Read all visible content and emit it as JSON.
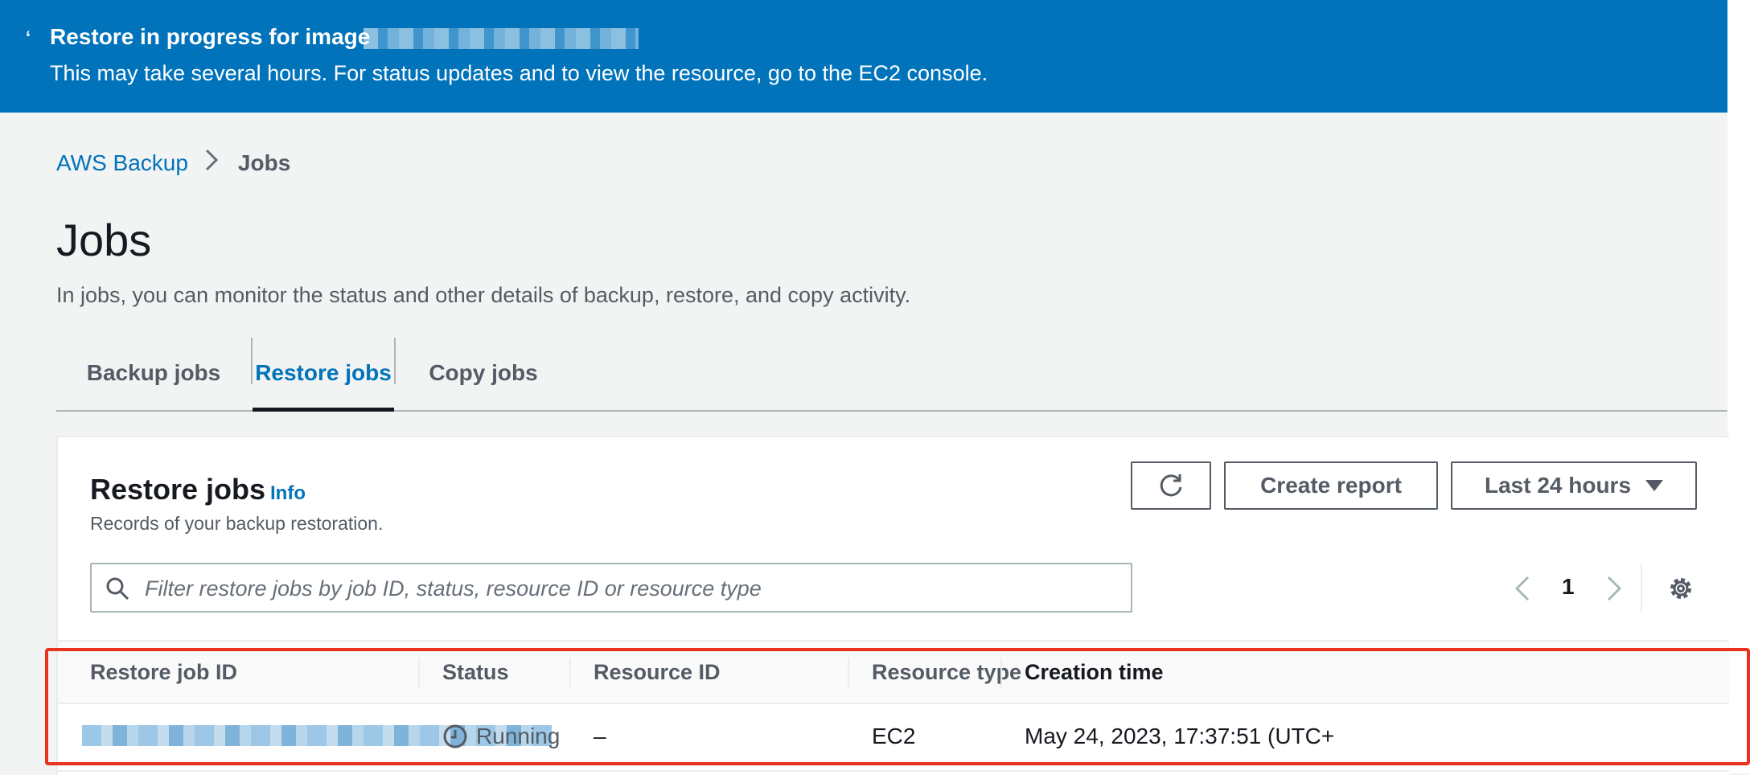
{
  "flash": {
    "title": "Restore in progress for image",
    "message": "This may take several hours. For status updates and to view the resource, go to the EC2 console.",
    "color": "#0073bb"
  },
  "breadcrumb": {
    "root": "AWS Backup",
    "current": "Jobs"
  },
  "page": {
    "title": "Jobs",
    "description": "In jobs, you can monitor the status and other details of backup, restore, and copy activity."
  },
  "tabs": [
    {
      "label": "Backup jobs",
      "active": false
    },
    {
      "label": "Restore jobs",
      "active": true
    },
    {
      "label": "Copy jobs",
      "active": false
    }
  ],
  "panel": {
    "title": "Restore jobs",
    "info": "Info",
    "description": "Records of your backup restoration.",
    "create_report": "Create report",
    "time_range": "Last 24 hours",
    "search_placeholder": "Filter restore jobs by job ID, status, resource ID or resource type",
    "page_number": "1"
  },
  "table": {
    "columns": [
      "Restore job ID",
      "Status",
      "Resource ID",
      "Resource type",
      "Creation time"
    ],
    "rows": [
      {
        "status": "Running",
        "resource_id": "–",
        "resource_type": "EC2",
        "creation_time": "May 24, 2023, 17:37:51 (UTC+"
      }
    ]
  },
  "colors": {
    "accent": "#0073bb",
    "highlight": "#e8321f"
  },
  "icons": [
    "spinner-icon",
    "chevron-right-icon",
    "refresh-icon",
    "caret-down-icon",
    "search-icon",
    "chevron-left-icon",
    "settings-icon",
    "clock-icon"
  ]
}
